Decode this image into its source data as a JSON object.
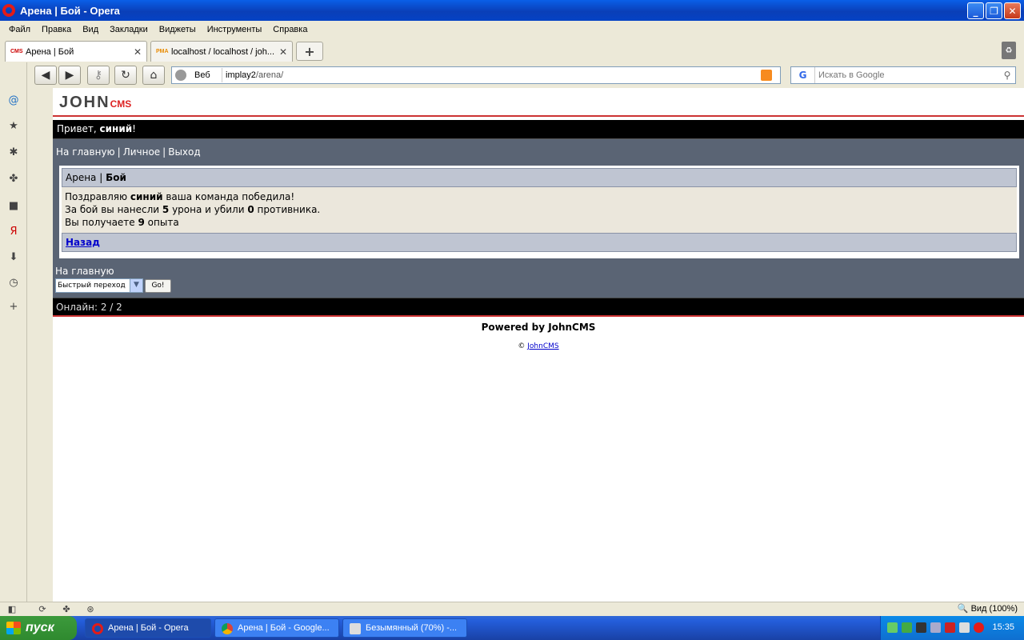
{
  "window": {
    "title": "Арена | Бой - Opera"
  },
  "menu": [
    "Файл",
    "Правка",
    "Вид",
    "Закладки",
    "Виджеты",
    "Инструменты",
    "Справка"
  ],
  "tabs": [
    {
      "label": "Арена | Бой",
      "favicon": "CMS",
      "active": true
    },
    {
      "label": "localhost / localhost / joh...",
      "favicon": "PMA",
      "active": false
    }
  ],
  "address": {
    "web_label": "Веб",
    "host": "implay2",
    "path": "/arena/"
  },
  "search": {
    "placeholder": "Искать в Google"
  },
  "page": {
    "logo_main": "JOHN",
    "logo_sub": "CMS",
    "greeting_prefix": "Привет, ",
    "greeting_name": "синий",
    "greeting_suffix": "!",
    "nav": [
      "На главную",
      "Личное",
      "Выход"
    ],
    "header_prefix": "Арена | ",
    "header_bold": "Бой",
    "result": {
      "line1_prefix": "Поздравляю ",
      "line1_name": "синий",
      "line1_suffix": " ваша команда победила!",
      "line2_prefix": "За бой вы нанесли ",
      "line2_damage": "5",
      "line2_mid": " урона и убили ",
      "line2_kills": "0",
      "line2_suffix": " противника.",
      "line3_prefix": "Вы получаете ",
      "line3_exp": "9",
      "line3_suffix": " опыта"
    },
    "back_label": "Назад",
    "home_label": "На главную",
    "quick_select": "Быстрый переход",
    "go_label": "Go!",
    "online": "Онлайн: 2 / 2",
    "powered": "Powered by JohnCMS",
    "copyright_symbol": "©",
    "copyright_link": "JohnCMS"
  },
  "statusbar": {
    "zoom": "Вид (100%)"
  },
  "taskbar": {
    "start": "пуск",
    "tasks": [
      "Арена | Бой - Opera",
      "Арена | Бой - Google...",
      "Безымянный (70%) -..."
    ],
    "clock": "15:35"
  }
}
